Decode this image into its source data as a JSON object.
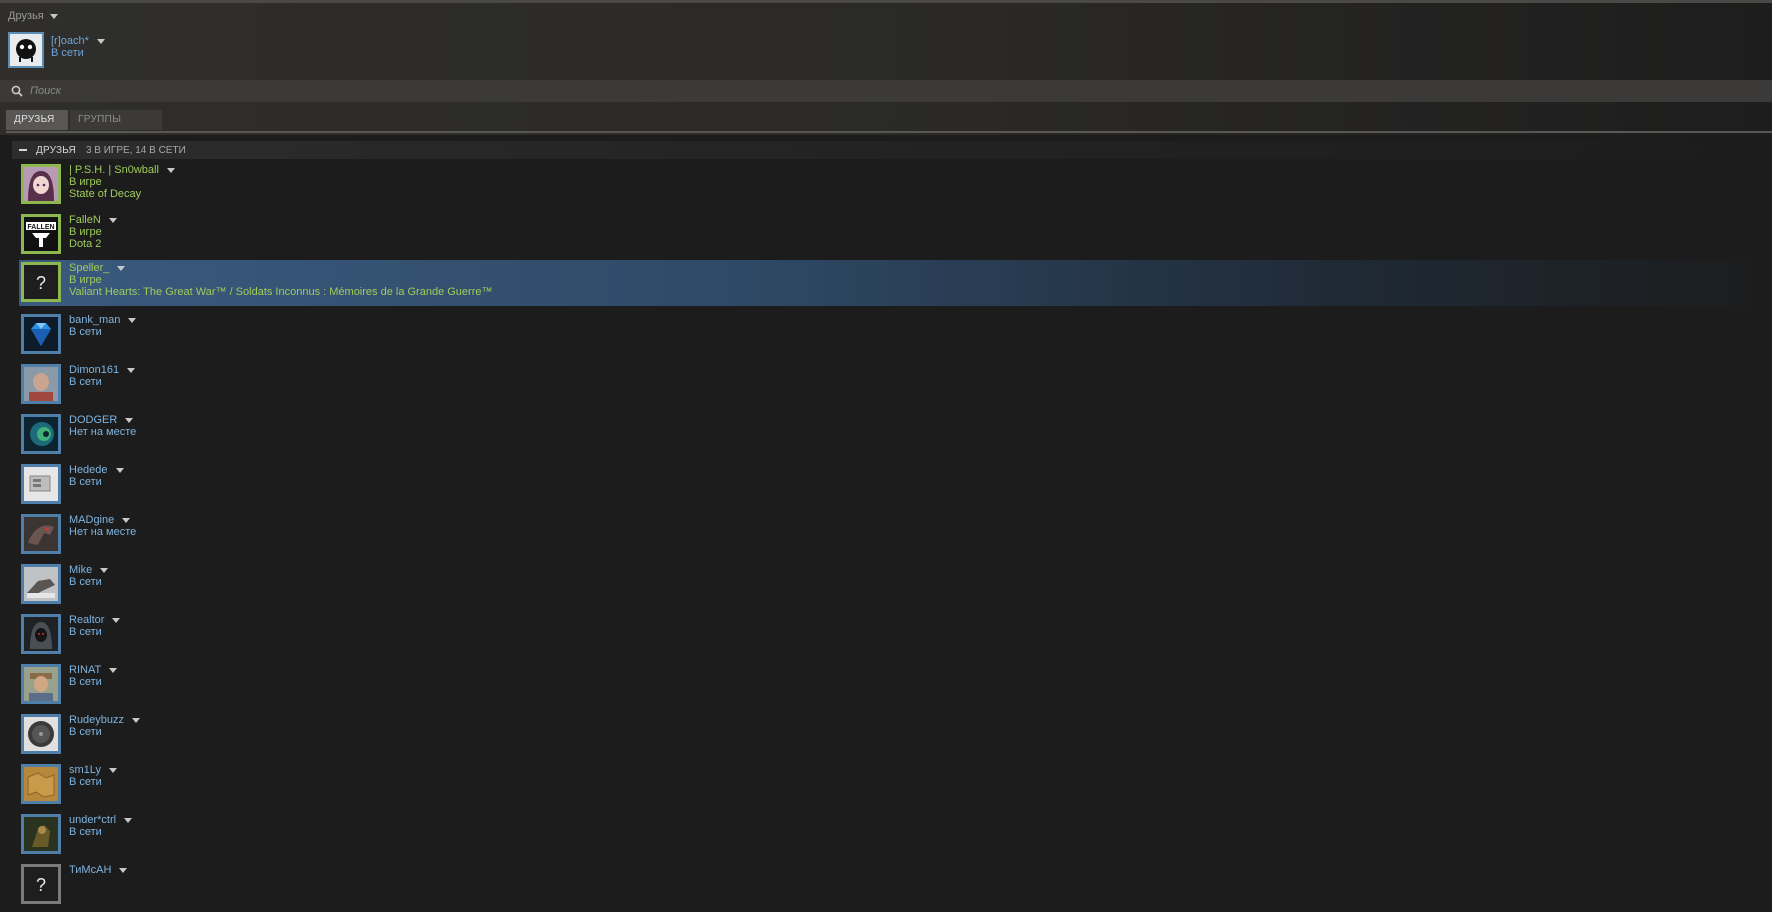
{
  "window": {
    "menu_label": "Друзья"
  },
  "me": {
    "name": "[r]oach*",
    "status": "В сети"
  },
  "search": {
    "placeholder": "Поиск"
  },
  "tabs": [
    {
      "label": "ДРУЗЬЯ",
      "active": true
    },
    {
      "label": "ГРУППЫ",
      "active": false
    }
  ],
  "group": {
    "title": "ДРУЗЬЯ",
    "counts": "3 В ИГРЕ, 14 В СЕТИ"
  },
  "friends": [
    {
      "name": "| P.S.H. | Sn0wball",
      "status": "В игре",
      "game": "State of Decay",
      "state": "ingame",
      "icon": "anime-avatar-icon"
    },
    {
      "name": "FalleN",
      "status": "В игре",
      "game": "Dota 2",
      "state": "ingame",
      "icon": "fallen-logo-icon"
    },
    {
      "name": "Speller_",
      "status": "В игре",
      "game": "Valiant Hearts: The Great War™ / Soldats Inconnus : Mémoires de la Grande Guerre™",
      "state": "ingame",
      "selected": true,
      "icon": "question-mark-icon"
    },
    {
      "name": "bank_man",
      "status": "В сети",
      "state": "online",
      "icon": "diamond-icon"
    },
    {
      "name": "Dimon161",
      "status": "В сети",
      "state": "online",
      "icon": "portrait-icon"
    },
    {
      "name": "DODGER",
      "status": "Нет на месте",
      "state": "away",
      "icon": "swirl-icon"
    },
    {
      "name": "Hedede",
      "status": "В сети",
      "state": "online",
      "icon": "console-icon"
    },
    {
      "name": "MADgine",
      "status": "Нет на месте",
      "state": "away",
      "icon": "creature-icon"
    },
    {
      "name": "Mike",
      "status": "В сети",
      "state": "online",
      "icon": "hand-icon"
    },
    {
      "name": "Realtor",
      "status": "В сети",
      "state": "online",
      "icon": "hooded-figure-icon"
    },
    {
      "name": "RINAT",
      "status": "В сети",
      "state": "online",
      "icon": "portrait-icon"
    },
    {
      "name": "Rudeybuzz",
      "status": "В сети",
      "state": "online",
      "icon": "disc-icon"
    },
    {
      "name": "sm1Ly",
      "status": "В сети",
      "state": "online",
      "icon": "map-icon"
    },
    {
      "name": "under*ctrl",
      "status": "В сети",
      "state": "online",
      "icon": "warrior-icon"
    },
    {
      "name": "ТиМсАН",
      "status": "",
      "state": "online",
      "icon": "question-mark-icon"
    }
  ],
  "colors": {
    "online": "#7eb4e0",
    "ingame": "#9fcc5c",
    "selected_row": "#3a5a7e",
    "background": "#1c1c1c"
  }
}
